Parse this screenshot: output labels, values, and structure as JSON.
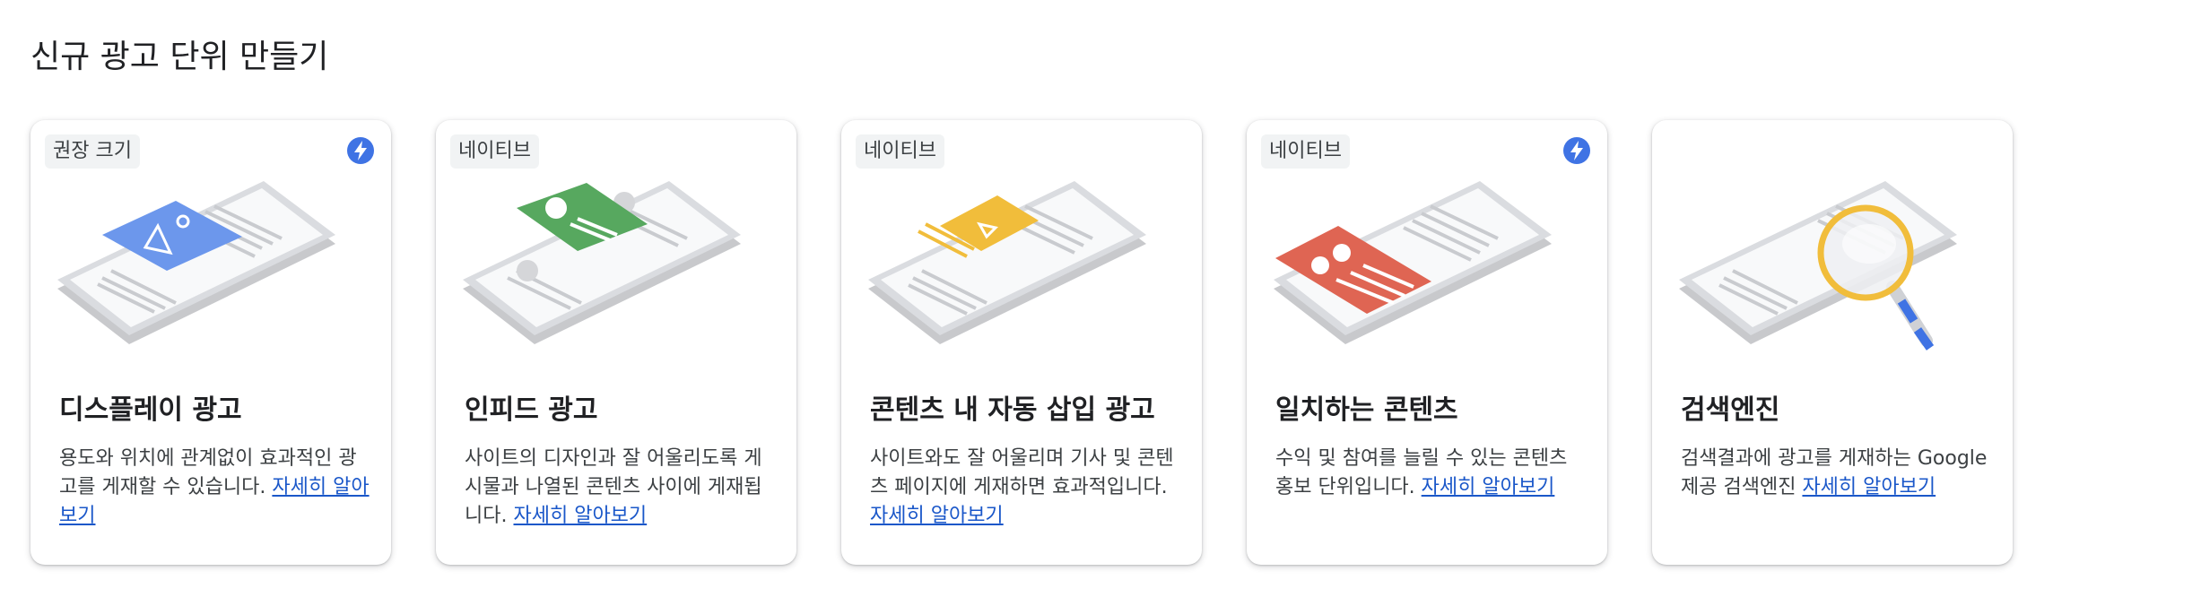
{
  "page": {
    "title": "신규 광고 단위 만들기"
  },
  "cards": [
    {
      "badge": "권장 크기",
      "lightning": true,
      "title": "디스플레이 광고",
      "description": "용도와 위치에 관계없이 효과적인 광고를 게재할 수 있습니다.",
      "link": "자세히 알아보기",
      "illustration": "display-ad-illustration",
      "accent": "#6c97ec"
    },
    {
      "badge": "네이티브",
      "lightning": false,
      "title": "인피드 광고",
      "description": "사이트의 디자인과 잘 어울리도록 게시물과 나열된 콘텐츠 사이에 게재됩니다.",
      "link": "자세히 알아보기",
      "illustration": "in-feed-ad-illustration",
      "accent": "#57a85f"
    },
    {
      "badge": "네이티브",
      "lightning": false,
      "title": "콘텐츠 내 자동 삽입 광고",
      "description": "사이트와도 잘 어울리며 기사 및 콘텐츠 페이지에 게재하면 효과적입니다.",
      "link": "자세히 알아보기",
      "illustration": "in-article-ad-illustration",
      "accent": "#f1bd3b"
    },
    {
      "badge": "네이티브",
      "lightning": true,
      "title": "일치하는 콘텐츠",
      "description": "수익 및 참여를 늘릴 수 있는 콘텐츠 홍보 단위입니다.",
      "link": "자세히 알아보기",
      "illustration": "matched-content-illustration",
      "accent": "#df6553"
    },
    {
      "badge": "",
      "lightning": false,
      "title": "검색엔진",
      "description": "검색결과에 광고를 게재하는 Google 제공 검색엔진",
      "link": "자세히 알아보기",
      "illustration": "search-engine-illustration",
      "accent": "#f1bd3b"
    }
  ],
  "colors": {
    "link": "#1a57c9",
    "lightning": "#3f73e4",
    "phone_body": "#dadce0",
    "phone_screen": "#f8f9fa"
  }
}
